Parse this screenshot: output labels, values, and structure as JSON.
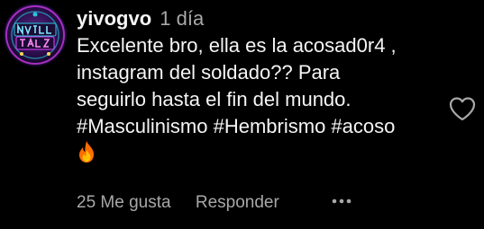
{
  "comment": {
    "username": "yivogvo",
    "timestamp": "1 día",
    "text_lines": [
      "Excelente bro, ella es la acosad0r4 ,",
      "instagram del soldado?? Para",
      "seguirlo hasta el fin del mundo.",
      "#Masculinismo #Hembrismo #acoso"
    ],
    "emoji": "fire-emoji",
    "likes_label": "25 Me gusta",
    "reply_label": "Responder",
    "icons": {
      "like": "heart-outline-icon",
      "more": "more-options-icon"
    },
    "colors": {
      "background": "#000000",
      "primary_text": "#f5f5f5",
      "secondary_text": "#a8a8a8",
      "avatar_accent_pink": "#e040fb",
      "avatar_accent_cyan": "#26c6da"
    }
  }
}
